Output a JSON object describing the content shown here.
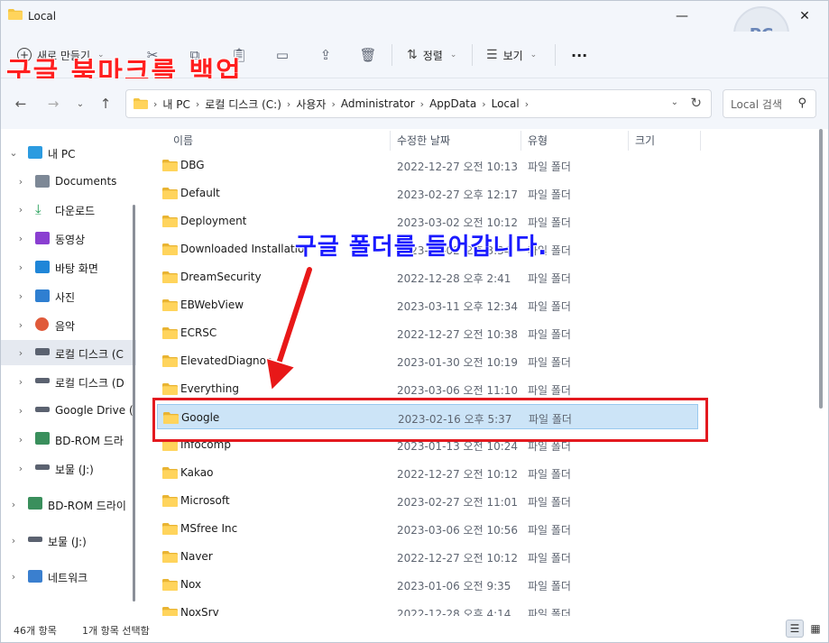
{
  "window": {
    "title": "Local",
    "minimize": "—",
    "maximize": "☐",
    "close": "✕"
  },
  "headline": "구글 북마크를 백업",
  "annotation": "구글 폴더를 들어갑니다.",
  "toolbar": {
    "new_label": "새로 만들기",
    "sort_label": "정렬",
    "view_label": "보기",
    "more_label": "···"
  },
  "address": {
    "crumbs": [
      "내 PC",
      "로컬 디스크 (C:)",
      "사용자",
      "Administrator",
      "AppData",
      "Local"
    ],
    "search_placeholder": "Local 검색"
  },
  "sidebar": {
    "items": [
      {
        "label": "내 PC",
        "icon": "pc-icon"
      },
      {
        "label": "Documents",
        "icon": "documents-icon"
      },
      {
        "label": "다운로드",
        "icon": "download-icon"
      },
      {
        "label": "동영상",
        "icon": "video-icon"
      },
      {
        "label": "바탕 화면",
        "icon": "desktop-icon"
      },
      {
        "label": "사진",
        "icon": "pictures-icon"
      },
      {
        "label": "음악",
        "icon": "music-icon"
      },
      {
        "label": "로컬 디스크 (C",
        "icon": "drive-icon"
      },
      {
        "label": "로컬 디스크 (D",
        "icon": "drive-icon"
      },
      {
        "label": "Google Drive (",
        "icon": "drive-icon"
      },
      {
        "label": "BD-ROM 드라",
        "icon": "bd-rom-icon"
      },
      {
        "label": "보물 (J:)",
        "icon": "drive-icon"
      },
      {
        "label": "BD-ROM 드라이",
        "icon": "bd-rom-icon"
      },
      {
        "label": "보물 (J:)",
        "icon": "drive-icon"
      },
      {
        "label": "네트워크",
        "icon": "network-icon"
      }
    ]
  },
  "columns": {
    "name": "이름",
    "date": "수정한 날짜",
    "type": "유형",
    "size": "크기"
  },
  "files": [
    {
      "name": "DBG",
      "date": "2022-12-27 오전 10:13",
      "type": "파일 폴더"
    },
    {
      "name": "Default",
      "date": "2023-02-27 오후 12:17",
      "type": "파일 폴더"
    },
    {
      "name": "Deployment",
      "date": "2023-03-02 오전 10:12",
      "type": "파일 폴더"
    },
    {
      "name": "Downloaded Installations",
      "date": "2023-03-02 오후 3:34",
      "type": "파일 폴더"
    },
    {
      "name": "DreamSecurity",
      "date": "2022-12-28 오후 2:41",
      "type": "파일 폴더"
    },
    {
      "name": "EBWebView",
      "date": "2023-03-11 오후 12:34",
      "type": "파일 폴더"
    },
    {
      "name": "ECRSC",
      "date": "2022-12-27 오전 10:38",
      "type": "파일 폴더"
    },
    {
      "name": "ElevatedDiagnos",
      "date": "2023-01-30 오전 10:19",
      "type": "파일 폴더"
    },
    {
      "name": "Everything",
      "date": "2023-03-06 오전 11:10",
      "type": "파일 폴더"
    },
    {
      "name": "Google",
      "date": "2023-02-16 오후 5:37",
      "type": "파일 폴더"
    },
    {
      "name": "Infocomp",
      "date": "2023-01-13 오전 10:24",
      "type": "파일 폴더"
    },
    {
      "name": "Kakao",
      "date": "2022-12-27 오전 10:12",
      "type": "파일 폴더"
    },
    {
      "name": "Microsoft",
      "date": "2023-02-27 오전 11:01",
      "type": "파일 폴더"
    },
    {
      "name": "MSfree Inc",
      "date": "2023-03-06 오전 10:56",
      "type": "파일 폴더"
    },
    {
      "name": "Naver",
      "date": "2022-12-27 오전 10:12",
      "type": "파일 폴더"
    },
    {
      "name": "Nox",
      "date": "2023-01-06 오전 9:35",
      "type": "파일 폴더"
    },
    {
      "name": "NoxSrv",
      "date": "2022-12-28 오후 4:14",
      "type": "파일 폴더"
    }
  ],
  "status": {
    "count": "46개 항목",
    "selected": "1개 항목 선택함"
  },
  "colors": {
    "accent": "#0067c0",
    "selection": "#cce4f7",
    "folder": "#f4c542",
    "headline": "#ff1f1f",
    "annotation": "#1a1aff",
    "highlight_box": "#e3191f"
  }
}
